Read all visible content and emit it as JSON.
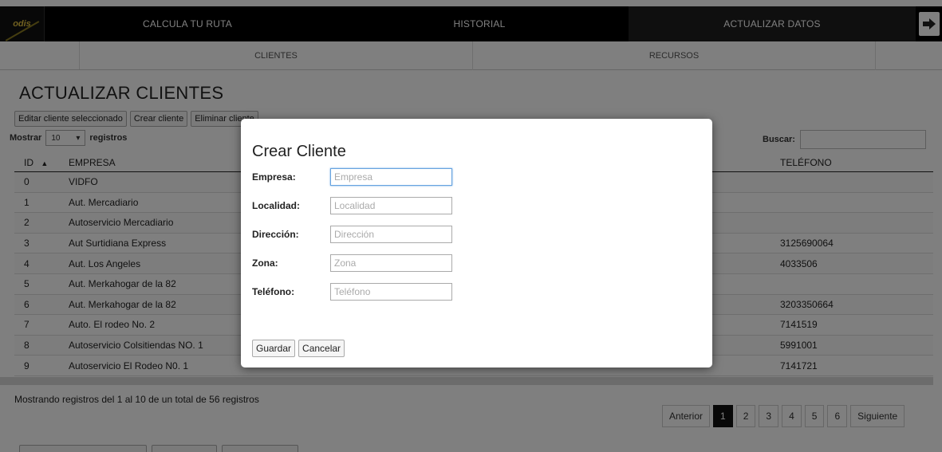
{
  "logo": {
    "text": "odis"
  },
  "topnav": {
    "items": [
      "CALCULA TU RUTA",
      "HISTORIAL",
      "ACTUALIZAR DATOS"
    ]
  },
  "subnav": {
    "items": [
      "CLIENTES",
      "RECURSOS"
    ]
  },
  "main": {
    "title": "ACTUALIZAR CLIENTES",
    "buttons": [
      "Editar cliente seleccionado",
      "Crear cliente",
      "Eliminar cliente"
    ],
    "show_label_pre": "Mostrar",
    "show_value": "10",
    "show_label_post": "registros",
    "search_label": "Buscar:",
    "search_value": ""
  },
  "table": {
    "headers": [
      "ID",
      "EMPRESA",
      "TELÉFONO"
    ],
    "rows": [
      {
        "id": "0",
        "empresa": "VIDFO",
        "telefono": ""
      },
      {
        "id": "1",
        "empresa": "Aut. Mercadiario",
        "telefono": ""
      },
      {
        "id": "2",
        "empresa": "Autoservicio Mercadiario",
        "telefono": ""
      },
      {
        "id": "3",
        "empresa": "Aut Surtidiana Express",
        "telefono": "3125690064"
      },
      {
        "id": "4",
        "empresa": "Aut. Los Angeles",
        "telefono": "4033506"
      },
      {
        "id": "5",
        "empresa": "Aut. Merkahogar de la 82",
        "telefono": ""
      },
      {
        "id": "6",
        "empresa": "Aut. Merkahogar de la 82",
        "telefono": "3203350664"
      },
      {
        "id": "7",
        "empresa": "Auto. El rodeo No. 2",
        "telefono": "7141519"
      },
      {
        "id": "8",
        "empresa": "Autoservicio Colsitiendas NO. 1",
        "telefono": "5991001"
      },
      {
        "id": "9",
        "empresa": "Autoservicio El Rodeo N0. 1",
        "telefono": "7141721"
      }
    ]
  },
  "footer": {
    "status": "Mostrando registros del 1 al 10 de un total de 56 registros",
    "pager": {
      "prev": "Anterior",
      "pages": [
        "1",
        "2",
        "3",
        "4",
        "5",
        "6"
      ],
      "next": "Siguiente",
      "active_page": "1"
    }
  },
  "modal": {
    "title": "Crear Cliente",
    "fields": [
      {
        "label": "Empresa:",
        "placeholder": "Empresa",
        "value": ""
      },
      {
        "label": "Localidad:",
        "placeholder": "Localidad",
        "value": ""
      },
      {
        "label": "Dirección:",
        "placeholder": "Dirección",
        "value": ""
      },
      {
        "label": "Zona:",
        "placeholder": "Zona",
        "value": ""
      },
      {
        "label": "Teléfono:",
        "placeholder": "Teléfono",
        "value": ""
      }
    ],
    "save_label": "Guardar",
    "cancel_label": "Cancelar"
  },
  "colors": {
    "nav_bg": "#000000",
    "nav_active": "#1f1f1f",
    "focus": "#66a3e0",
    "overlay": "rgba(0,0,0,0.5)"
  },
  "icons": {
    "exit": "exit-arrow-icon",
    "sort": "sort-asc-icon",
    "dropdown": "chevron-down-icon"
  }
}
